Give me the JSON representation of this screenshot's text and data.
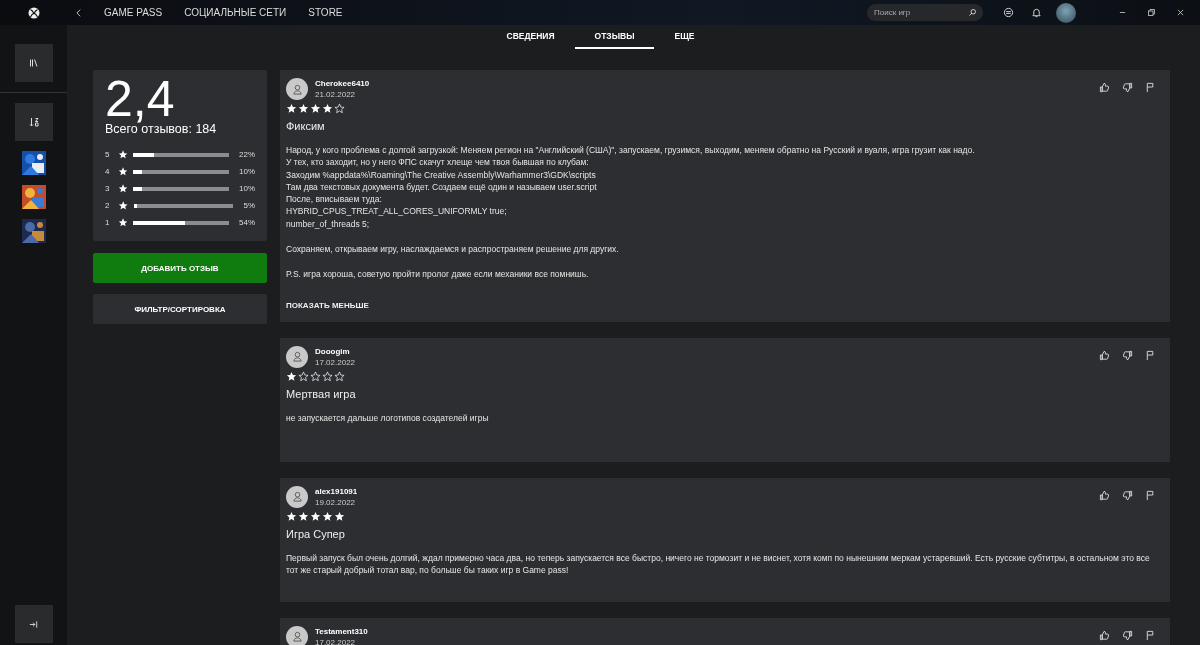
{
  "top_bar": {
    "nav": [
      {
        "label": "GAME PASS"
      },
      {
        "label": "СОЦИАЛЬНЫЕ СЕТИ"
      },
      {
        "label": "STORE"
      }
    ],
    "search": {
      "placeholder": "Поиск игр"
    }
  },
  "tabs": [
    {
      "label": "СВЕДЕНИЯ",
      "selected": false
    },
    {
      "label": "ОТЗЫВЫ",
      "selected": true
    },
    {
      "label": "ЕЩЕ",
      "selected": false
    }
  ],
  "summary": {
    "rating": "2,4",
    "total": "Всего отзывов: 184",
    "distribution": [
      {
        "label": "5",
        "level": 0.22,
        "percent": "22%"
      },
      {
        "label": "4",
        "level": 0.1,
        "percent": "10%"
      },
      {
        "label": "3",
        "level": 0.1,
        "percent": "10%"
      },
      {
        "label": "2",
        "level": 0.03,
        "percent": "5%"
      },
      {
        "label": "1",
        "level": 0.54,
        "percent": "54%"
      }
    ]
  },
  "buttons": [
    {
      "label": "ДОБАВИТЬ ОТЗЫВ",
      "kind": "primary"
    },
    {
      "label": "ФИЛЬТР/СОРТИРОВКА",
      "kind": "secondary"
    }
  ],
  "reviews": [
    {
      "author": "Cherokee6410",
      "date": "21.02.2022",
      "stars": 4,
      "title": "Фиксим",
      "paragraphs": [
        "Народ, у кого проблема с долгой загрузкой: Меняем регион на \"Английский (США)\", запускаем, грузимся, выходим, меняем обратно на Русский и вуаля, игра грузит как надо.\nУ тех, кто заходит, но у него ФПС скачут хлеще чем твоя бывшая по клубам:\nЗаходим %appdata%\\Roaming\\The Creative Assembly\\Warhammer3\\GDK\\scripts\nТам два текстовых документа будет. Создаем ещё один и называем user.script\nПосле, вписываем туда:\nHYBRID_CPUS_TREAT_ALL_CORES_UNIFORMLY true;\nnumber_of_threads 5;",
        "Сохраняем, открываем игру, наслаждаемся  и распространяем решение для других.",
        "P.S. игра хороша, советую пройти пролог даже если механики все помнишь."
      ],
      "toggle": "ПОКАЗАТЬ МЕНЬШЕ"
    },
    {
      "author": "Dooogim",
      "date": "17.02.2022",
      "stars": 1,
      "title": "Мертвая игра",
      "paragraphs": [
        "не запускается дальше логотипов создателей игры"
      ]
    },
    {
      "author": "alex191091",
      "date": "19.02.2022",
      "stars": 5,
      "title": "Игра Супер",
      "paragraphs": [
        "Первый запуск был очень долгий, ждал примерно часа два, но теперь запускается все быстро, ничего не тормозит и не виснет, хотя комп по нынешним меркам устаревший. Есть русские субтитры, в остальном это все\nтот же старый добрый тотал вар, по больше бы таких игр в Game pass!"
      ]
    },
    {
      "author": "Testament310",
      "date": "17.02.2022"
    }
  ]
}
